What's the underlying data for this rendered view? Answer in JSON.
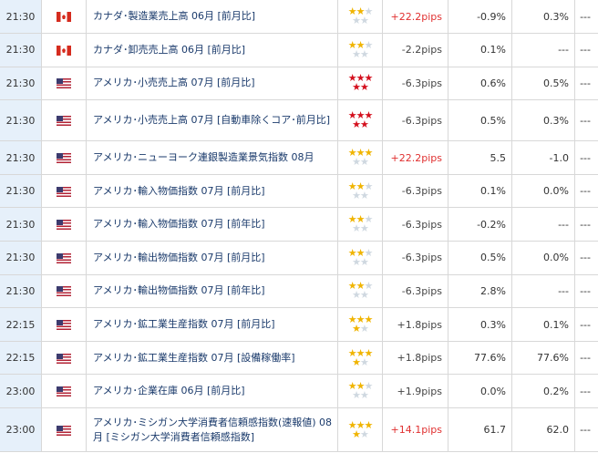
{
  "rows": [
    {
      "time": "21:30",
      "country": "ca",
      "event": "カナダ･製造業売上高 06月 [前月比]",
      "stars": 2,
      "star_color": "yellow",
      "pips": "+22.2pips",
      "pips_sign": "pos",
      "v1": "-0.9%",
      "v2": "0.3%",
      "v3": "---"
    },
    {
      "time": "21:30",
      "country": "ca",
      "event": "カナダ･卸売売上高 06月 [前月比]",
      "stars": 2,
      "star_color": "yellow",
      "pips": "-2.2pips",
      "pips_sign": "neg",
      "v1": "0.1%",
      "v2": "---",
      "v3": "---"
    },
    {
      "time": "21:30",
      "country": "us",
      "event": "アメリカ･小売売上高 07月 [前月比]",
      "stars": 5,
      "star_color": "red",
      "pips": "-6.3pips",
      "pips_sign": "neg",
      "v1": "0.6%",
      "v2": "0.5%",
      "v3": "---"
    },
    {
      "time": "21:30",
      "country": "us",
      "event": "アメリカ･小売売上高 07月 [自動車除くコア･前月比]",
      "stars": 5,
      "star_color": "red",
      "pips": "-6.3pips",
      "pips_sign": "neg",
      "v1": "0.5%",
      "v2": "0.3%",
      "v3": "---"
    },
    {
      "time": "21:30",
      "country": "us",
      "event": "アメリカ･ニューヨーク連銀製造業景気指数 08月",
      "stars": 3,
      "star_color": "yellow",
      "pips": "+22.2pips",
      "pips_sign": "pos",
      "v1": "5.5",
      "v2": "-1.0",
      "v3": "---"
    },
    {
      "time": "21:30",
      "country": "us",
      "event": "アメリカ･輸入物価指数 07月 [前月比]",
      "stars": 2,
      "star_color": "yellow",
      "pips": "-6.3pips",
      "pips_sign": "neg",
      "v1": "0.1%",
      "v2": "0.0%",
      "v3": "---"
    },
    {
      "time": "21:30",
      "country": "us",
      "event": "アメリカ･輸入物価指数 07月 [前年比]",
      "stars": 2,
      "star_color": "yellow",
      "pips": "-6.3pips",
      "pips_sign": "neg",
      "v1": "-0.2%",
      "v2": "---",
      "v3": "---"
    },
    {
      "time": "21:30",
      "country": "us",
      "event": "アメリカ･輸出物価指数 07月 [前月比]",
      "stars": 2,
      "star_color": "yellow",
      "pips": "-6.3pips",
      "pips_sign": "neg",
      "v1": "0.5%",
      "v2": "0.0%",
      "v3": "---"
    },
    {
      "time": "21:30",
      "country": "us",
      "event": "アメリカ･輸出物価指数 07月 [前年比]",
      "stars": 2,
      "star_color": "yellow",
      "pips": "-6.3pips",
      "pips_sign": "neg",
      "v1": "2.8%",
      "v2": "---",
      "v3": "---"
    },
    {
      "time": "22:15",
      "country": "us",
      "event": "アメリカ･鉱工業生産指数 07月 [前月比]",
      "stars": 4,
      "star_color": "yellow",
      "pips": "+1.8pips",
      "pips_sign": "neg",
      "v1": "0.3%",
      "v2": "0.1%",
      "v3": "---"
    },
    {
      "time": "22:15",
      "country": "us",
      "event": "アメリカ･鉱工業生産指数 07月 [設備稼働率]",
      "stars": 4,
      "star_color": "yellow",
      "pips": "+1.8pips",
      "pips_sign": "neg",
      "v1": "77.6%",
      "v2": "77.6%",
      "v3": "---"
    },
    {
      "time": "23:00",
      "country": "us",
      "event": "アメリカ･企業在庫 06月 [前月比]",
      "stars": 2,
      "star_color": "yellow",
      "pips": "+1.9pips",
      "pips_sign": "neg",
      "v1": "0.0%",
      "v2": "0.2%",
      "v3": "---"
    },
    {
      "time": "23:00",
      "country": "us",
      "event": "アメリカ･ミシガン大学消費者信頼感指数(速報値) 08月 [ミシガン大学消費者信頼感指数]",
      "stars": 4,
      "star_color": "yellow",
      "pips": "+14.1pips",
      "pips_sign": "pos",
      "v1": "61.7",
      "v2": "62.0",
      "v3": "---"
    }
  ]
}
